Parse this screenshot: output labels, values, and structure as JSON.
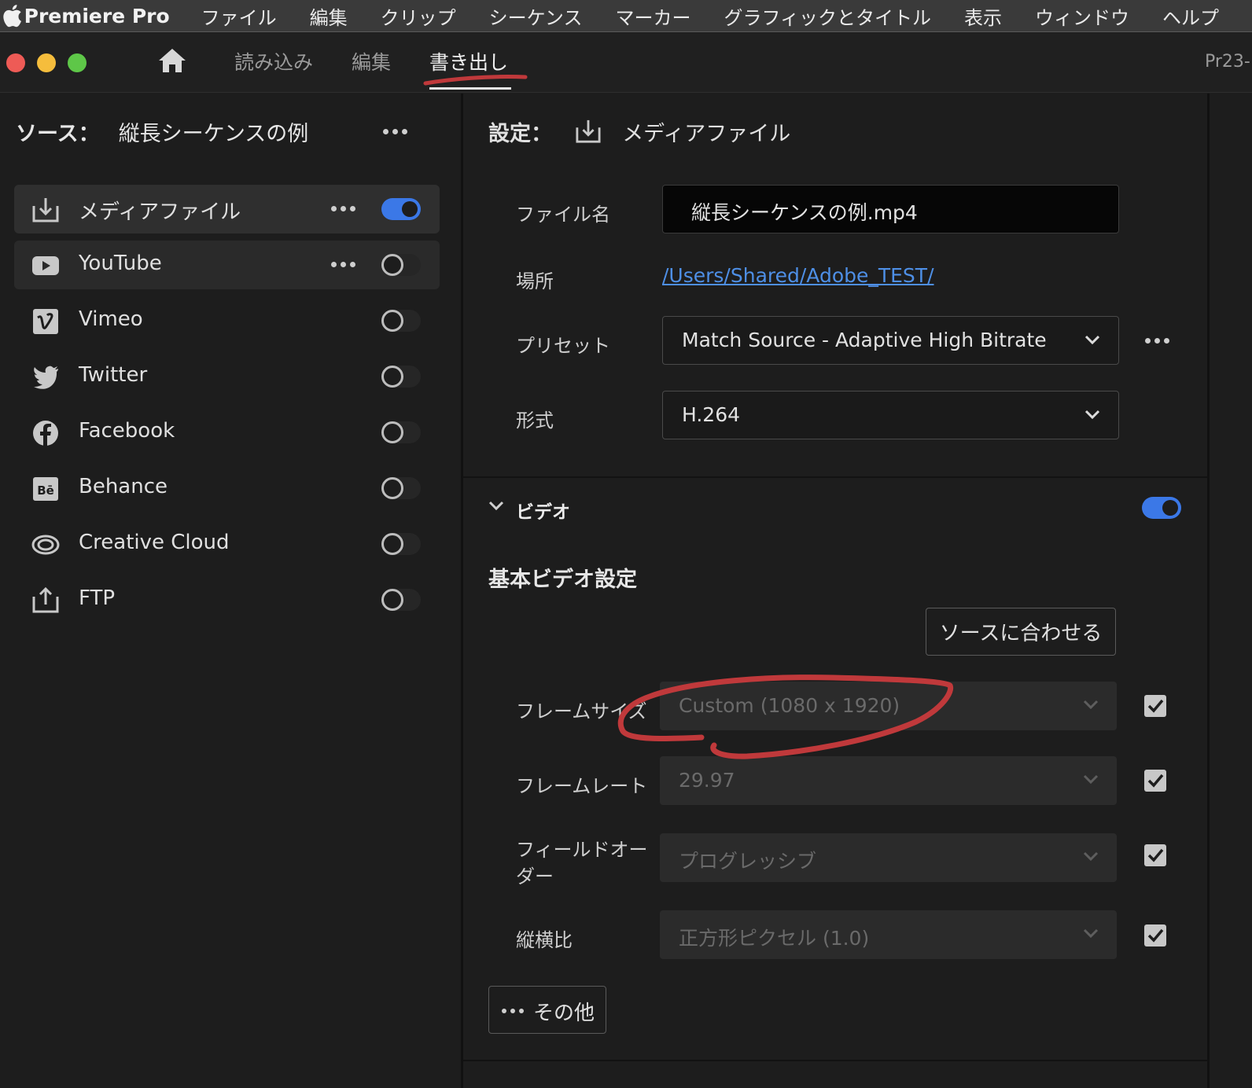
{
  "menubar": {
    "app_name": "Premiere Pro",
    "items": [
      "ファイル",
      "編集",
      "クリップ",
      "シーケンス",
      "マーカー",
      "グラフィックとタイトル",
      "表示",
      "ウィンドウ",
      "ヘルプ"
    ]
  },
  "workspace": {
    "tabs": [
      "読み込み",
      "編集",
      "書き出し"
    ],
    "active_tab": "書き出し",
    "project_label": "Pr23-"
  },
  "source": {
    "label": "ソース：",
    "name": "縦長シーケンスの例"
  },
  "destinations": [
    {
      "label": "メディアファイル",
      "icon": "export-icon",
      "enabled": true,
      "has_menu": true
    },
    {
      "label": "YouTube",
      "icon": "youtube-icon",
      "enabled": false,
      "has_menu": true
    },
    {
      "label": "Vimeo",
      "icon": "vimeo-icon",
      "enabled": false,
      "has_menu": false
    },
    {
      "label": "Twitter",
      "icon": "twitter-icon",
      "enabled": false,
      "has_menu": false
    },
    {
      "label": "Facebook",
      "icon": "facebook-icon",
      "enabled": false,
      "has_menu": false
    },
    {
      "label": "Behance",
      "icon": "behance-icon",
      "enabled": false,
      "has_menu": false
    },
    {
      "label": "Creative Cloud",
      "icon": "creative-cloud-icon",
      "enabled": false,
      "has_menu": false
    },
    {
      "label": "FTP",
      "icon": "upload-icon",
      "enabled": false,
      "has_menu": false
    }
  ],
  "settings": {
    "label": "設定：",
    "target": "メディアファイル",
    "filename_label": "ファイル名",
    "filename": "縦長シーケンスの例.mp4",
    "location_label": "場所",
    "location": "/Users/Shared/Adobe_TEST/",
    "preset_label": "プリセット",
    "preset": "Match Source - Adaptive High Bitrate",
    "format_label": "形式",
    "format": "H.264"
  },
  "video": {
    "section_title": "ビデオ",
    "enabled": true,
    "basic_title": "基本ビデオ設定",
    "match_source_button": "ソースに合わせる",
    "frame_size_label": "フレームサイズ",
    "frame_size": "Custom (1080 x 1920)",
    "frame_rate_label": "フレームレート",
    "frame_rate": "29.97",
    "field_order_label_line1": "フィールドオー",
    "field_order_label_line2": "ダー",
    "field_order": "プログレッシブ",
    "aspect_label": "縦横比",
    "aspect": "正方形ピクセル (1.0)",
    "more_button": "その他"
  },
  "colors": {
    "accent_blue": "#3b78e7",
    "link_blue": "#4e8fe6",
    "annotation_red": "#c0393b"
  }
}
